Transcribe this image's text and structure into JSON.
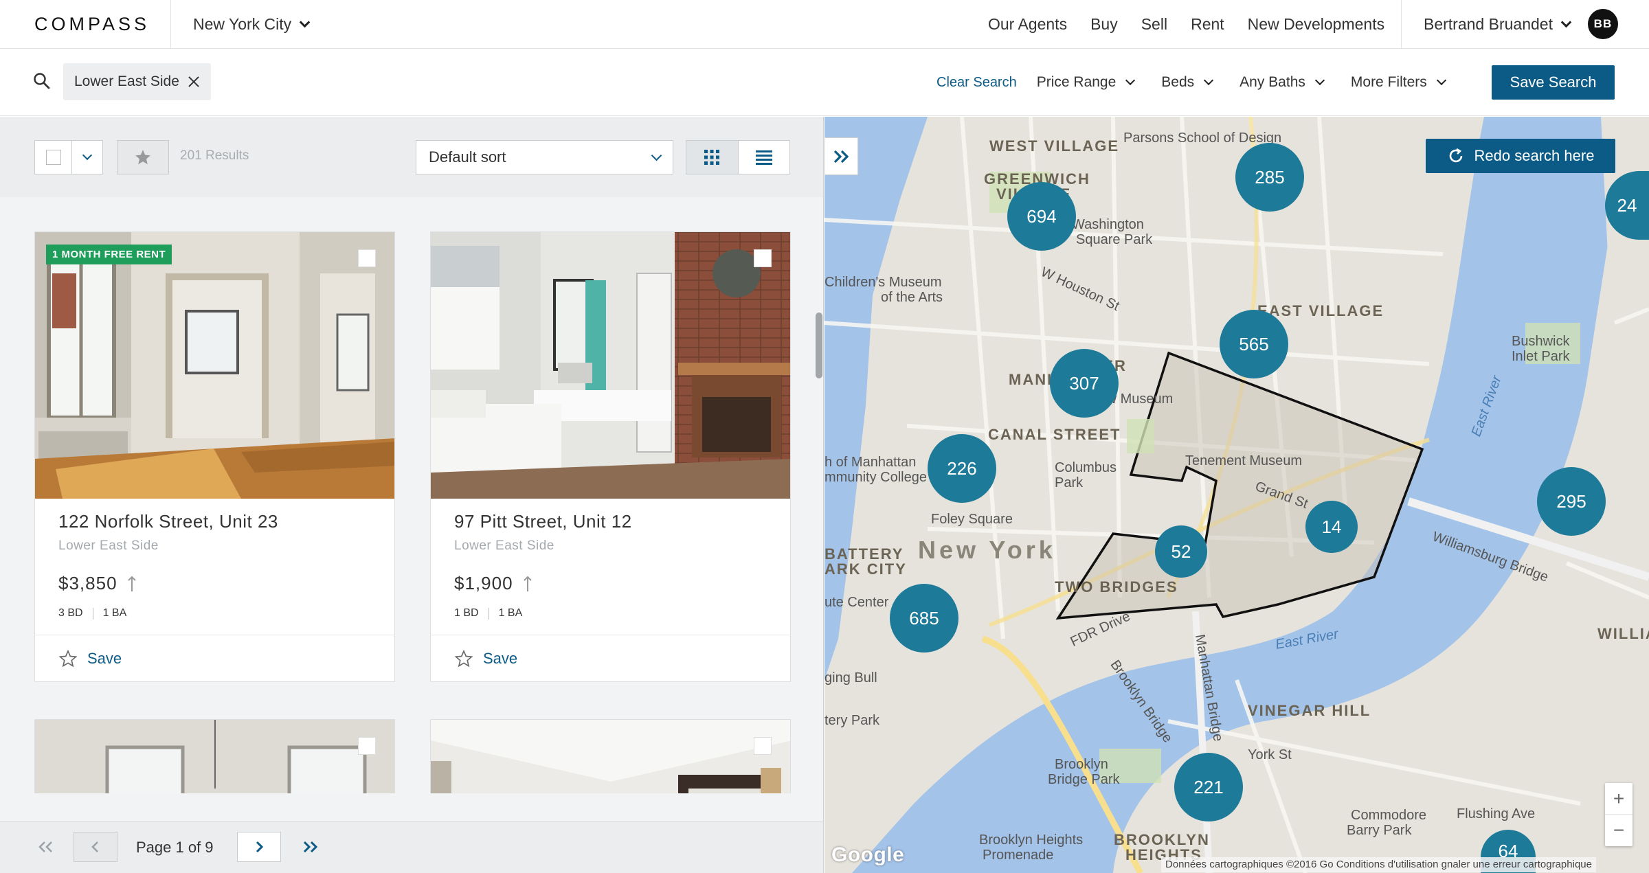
{
  "brand": {
    "logo": "COMPASS"
  },
  "header": {
    "city": "New York City",
    "nav": [
      "Our Agents",
      "Buy",
      "Sell",
      "Rent",
      "New Developments"
    ],
    "user_name": "Bertrand Bruandet",
    "user_initials": "BB"
  },
  "search": {
    "chip": "Lower East Side",
    "clear_label": "Clear Search",
    "filters": [
      "Price Range",
      "Beds",
      "Any Baths",
      "More Filters"
    ],
    "save_label": "Save Search"
  },
  "toolbar": {
    "results": "201 Results",
    "sort": "Default sort"
  },
  "listings": [
    {
      "promo": "1 MONTH FREE RENT",
      "address": "122 Norfolk Street, Unit 23",
      "neighborhood": "Lower East Side",
      "price": "$3,850",
      "beds": "3 BD",
      "baths": "1 BA",
      "save": "Save"
    },
    {
      "promo": "",
      "address": "97 Pitt Street, Unit 12",
      "neighborhood": "Lower East Side",
      "price": "$1,900",
      "beds": "1 BD",
      "baths": "1 BA",
      "save": "Save"
    }
  ],
  "pager": {
    "label": "Page 1 of 9"
  },
  "map": {
    "redo_label": "Redo search here",
    "clusters": [
      "285",
      "694",
      "565",
      "307",
      "226",
      "52",
      "14",
      "685",
      "221",
      "295",
      "24",
      "64"
    ],
    "labels": {
      "west_village": "WEST VILLAGE",
      "parsons": "Parsons School of Design",
      "greenwich": "GREENWICH",
      "village": "VILLAGE",
      "washington": "Washington",
      "square_park": "Square Park",
      "childrens1": "Children's Museum",
      "childrens2": "of the Arts",
      "east_village": "EAST VILLAGE",
      "lower": "LOWER",
      "manhattan": "MANHATTAN",
      "new_museum": "New Museum",
      "canal": "CANAL STREET",
      "tenement": "Tenement Museum",
      "columbus1": "Columbus",
      "columbus2": "Park",
      "bmcc1": "h of Manhattan",
      "bmcc2": "mmunity College",
      "foley": "Foley Square",
      "new_york": "New York",
      "battery1": "BATTERY",
      "battery2": "ARK CITY",
      "two_bridges": "TWO BRIDGES",
      "ute_center": "ute Center",
      "east_river_a": "East River",
      "east_river_b": "East River",
      "williamsburg_bridge": "Williamsburg Bridge",
      "bushwick1": "Bushwick",
      "bushwick2": "Inlet Park",
      "william": "WILLIAM",
      "vinegar": "VINEGAR HILL",
      "bull": "ging Bull",
      "tery_park": "tery Park",
      "brooklyn_bridge_park1": "Brooklyn",
      "brooklyn_bridge_park2": "Bridge Park",
      "commodore1": "Commodore",
      "commodore2": "Barry Park",
      "flushing": "Flushing Ave",
      "bk_heights1": "Brooklyn Heights",
      "bk_heights2": "Promenade",
      "bk_heights3": "BROOKLYN",
      "bk_heights4": "HEIGHTS",
      "fdr": "FDR Drive",
      "manhattan_bridge": "Manhattan Bridge",
      "brooklyn_bridge": "Brooklyn Bridge",
      "grand": "Grand St",
      "houston": "W Houston St",
      "york": "York St"
    },
    "google": "Google",
    "attribution": "Données cartographiques ©2016 Go  Conditions d'utilisation  gnaler une erreur cartographique"
  },
  "colors": {
    "brand_blue": "#0c5b87",
    "cluster": "#1d7a99",
    "promo_green": "#1f9e5b",
    "water": "#a4c3e9"
  }
}
